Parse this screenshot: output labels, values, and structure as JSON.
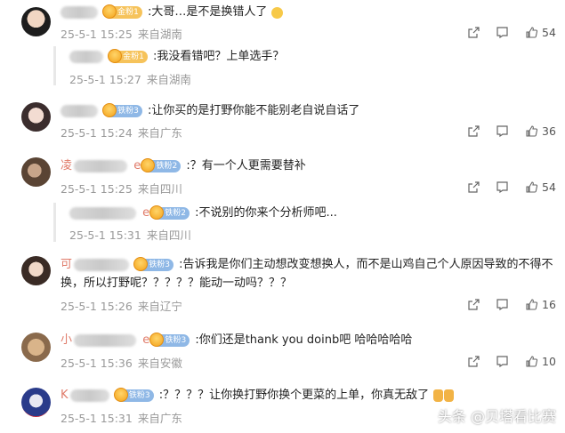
{
  "comments": [
    {
      "text": ":大哥…是不是换错人了",
      "fan_badge": "金粉1",
      "date": "25-5-1 15:25",
      "location": "来自湖南",
      "likes": "54",
      "reply": {
        "text": ":我没看错吧？上单选手？",
        "fan_badge": "金粉1",
        "date": "25-5-1 15:27",
        "location": "来自湖南"
      }
    },
    {
      "text": ":让你买的是打野你能不能别老自说自话了",
      "fan_badge": "铁粉3",
      "date": "25-5-1 15:24",
      "location": "来自广东",
      "likes": "36"
    },
    {
      "name_letters": "凌",
      "name_suffix": "e",
      "text": ":？有一个人更需要替补",
      "fan_badge": "铁粉2",
      "date": "25-5-1 15:25",
      "location": "来自四川",
      "likes": "54",
      "reply": {
        "name_suffix": "e",
        "text": ":不说别的你来个分析师吧...",
        "fan_badge": "铁粉2",
        "date": "25-5-1 15:31",
        "location": "来自四川"
      }
    },
    {
      "name_letters": "可",
      "text_line1": ":告诉我是你们主动想改变想换人，而不是山鸡自己个人原因导致的不得不",
      "text_line2": "换，所以打野呢？？？？？能动一动吗？？？",
      "fan_badge": "铁粉3",
      "date": "25-5-1 15:26",
      "location": "来自辽宁",
      "likes": "16"
    },
    {
      "name_letters": "小",
      "name_suffix": "e",
      "text": ":你们还是thank you  doinb吧 哈哈哈哈哈",
      "fan_badge": "铁粉3",
      "date": "25-5-1 15:36",
      "location": "来自安徽",
      "likes": "10"
    },
    {
      "name_letters": "K",
      "text": ":？？？？让你换打野你换个更菜的上单，你真无敌了",
      "fan_badge": "铁粉3",
      "date": "25-5-1 15:31",
      "location": "来自广东"
    }
  ],
  "icons": {
    "share": "share-icon",
    "comment": "comment-icon",
    "like": "thumbs-up-icon"
  },
  "watermark": "头条 @贝塔看比赛",
  "colors": {
    "gold_badge": "#f6c35b",
    "iron_badge": "#8fb8e6",
    "meta_text": "#999999"
  }
}
